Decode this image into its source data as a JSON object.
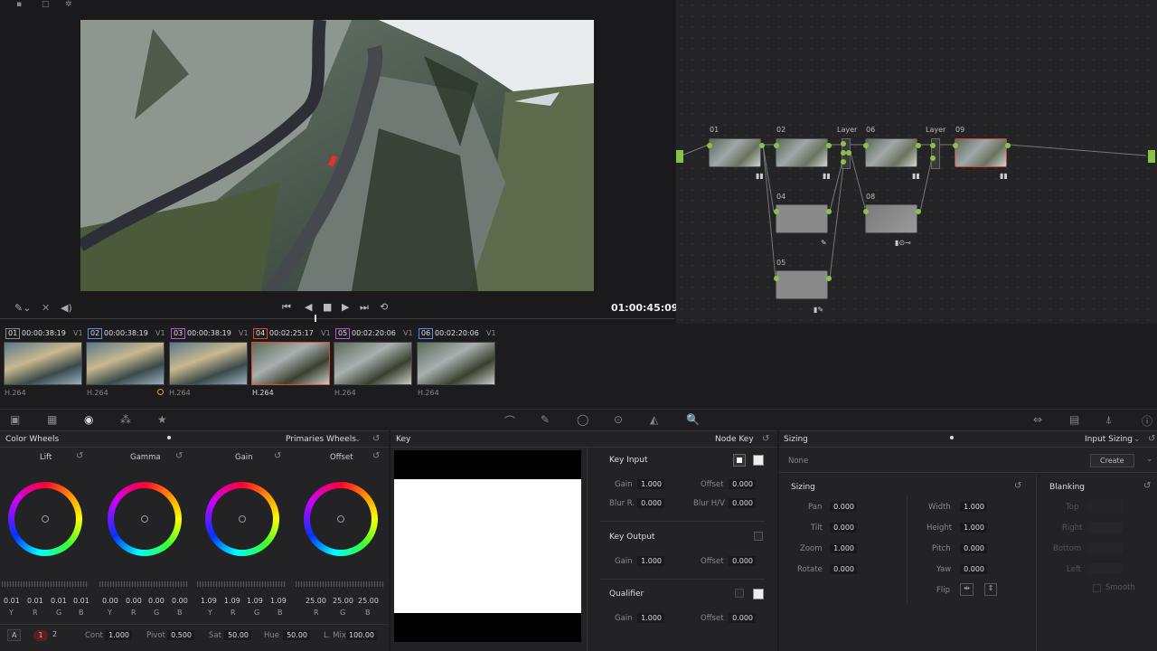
{
  "viewer": {
    "timecode": "01:00:45:09"
  },
  "nodes": {
    "labels": [
      "01",
      "02",
      "Layer",
      "06",
      "Layer",
      "09",
      "04",
      "08",
      "05"
    ]
  },
  "clips": [
    {
      "num": "01",
      "time": "00:00:38:19",
      "track": "V1",
      "codec": "H.264"
    },
    {
      "num": "02",
      "time": "00:00:38:19",
      "track": "V1",
      "codec": "H.264"
    },
    {
      "num": "03",
      "time": "00:00:38:19",
      "track": "V1",
      "codec": "H.264"
    },
    {
      "num": "04",
      "time": "00:02:25:17",
      "track": "V1",
      "codec": "H.264"
    },
    {
      "num": "05",
      "time": "00:02:20:06",
      "track": "V1",
      "codec": "H.264"
    },
    {
      "num": "06",
      "time": "00:02:20:06",
      "track": "V1",
      "codec": "H.264"
    }
  ],
  "color": {
    "title": "Color Wheels",
    "mode": "Primaries Wheels",
    "wheels": [
      {
        "name": "Lift",
        "vals": [
          "0.01",
          "0.01",
          "0.01",
          "0.01"
        ],
        "ch": [
          "Y",
          "R",
          "G",
          "B"
        ]
      },
      {
        "name": "Gamma",
        "vals": [
          "0.00",
          "0.00",
          "0.00",
          "0.00"
        ],
        "ch": [
          "Y",
          "R",
          "G",
          "B"
        ]
      },
      {
        "name": "Gain",
        "vals": [
          "1.09",
          "1.09",
          "1.09",
          "1.09"
        ],
        "ch": [
          "Y",
          "R",
          "G",
          "B"
        ]
      },
      {
        "name": "Offset",
        "vals": [
          "25.00",
          "25.00",
          "25.00"
        ],
        "ch": [
          "R",
          "G",
          "B"
        ]
      }
    ],
    "bottom": {
      "a": "A",
      "p1": "1",
      "p2": "2",
      "cont_l": "Cont",
      "cont": "1.000",
      "pivot_l": "Pivot",
      "pivot": "0.500",
      "sat_l": "Sat",
      "sat": "50.00",
      "hue_l": "Hue",
      "hue": "50.00",
      "lmix_l": "L. Mix",
      "lmix": "100.00"
    }
  },
  "key": {
    "title": "Key",
    "node_key": "Node Key",
    "input": {
      "title": "Key Input",
      "gain_l": "Gain",
      "gain": "1.000",
      "offset_l": "Offset",
      "offset": "0.000",
      "blur_l": "Blur R.",
      "blur": "0.000",
      "blurhv_l": "Blur H/V",
      "blurhv": "0.000"
    },
    "output": {
      "title": "Key Output",
      "gain_l": "Gain",
      "gain": "1.000",
      "offset_l": "Offset",
      "offset": "0.000"
    },
    "qual": {
      "title": "Qualifier",
      "gain_l": "Gain",
      "gain": "1.000",
      "offset_l": "Offset",
      "offset": "0.000"
    }
  },
  "sizing": {
    "title": "Sizing",
    "mode": "Input Sizing",
    "preset": "None",
    "create": "Create",
    "sub": "Sizing",
    "left": [
      {
        "l": "Pan",
        "v": "0.000"
      },
      {
        "l": "Tilt",
        "v": "0.000"
      },
      {
        "l": "Zoom",
        "v": "1.000"
      },
      {
        "l": "Rotate",
        "v": "0.000"
      }
    ],
    "right": [
      {
        "l": "Width",
        "v": "1.000"
      },
      {
        "l": "Height",
        "v": "1.000"
      },
      {
        "l": "Pitch",
        "v": "0.000"
      },
      {
        "l": "Yaw",
        "v": "0.000"
      }
    ],
    "flip": "Flip",
    "blanking": {
      "title": "Blanking",
      "items": [
        "Top",
        "Right",
        "Bottom",
        "Left"
      ],
      "smooth": "Smooth"
    }
  }
}
